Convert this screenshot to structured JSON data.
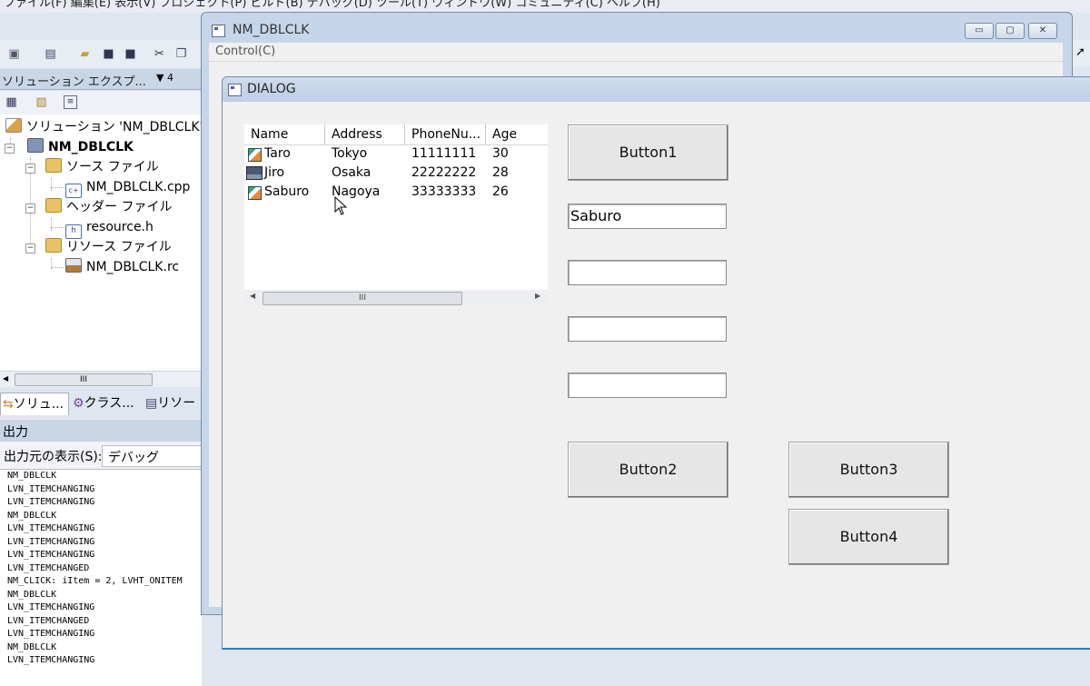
{
  "ide": {
    "menubar_text": "ファイル(F)   編集(E)   表示(V)   プロジェクト(P)   ビルド(B)   デバッグ(D)   ツール(T)   ウィンドウ(W)   コミュニティ(C)   ヘルプ(H)",
    "solution_explorer": {
      "title": "ソリューション エクスプ...",
      "pin": "▼ 4",
      "tree": {
        "solution": "ソリューション 'NM_DBLCLK'",
        "project": "NM_DBLCLK",
        "source_folder": "ソース ファイル",
        "source_file": "NM_DBLCLK.cpp",
        "header_folder": "ヘッダー ファイル",
        "header_file": "resource.h",
        "resource_folder": "リソース ファイル",
        "resource_file": "NM_DBLCLK.rc"
      },
      "scroll_thumb": "III",
      "tabs": [
        "ソリュ...",
        "クラス...",
        "リソー"
      ]
    },
    "output": {
      "title": "出力",
      "source_label": "出力元の表示(S):",
      "source_value": "デバッグ",
      "log": [
        "NM_DBLCLK",
        "LVN_ITEMCHANGING",
        "LVN_ITEMCHANGING",
        "NM_DBLCLK",
        "LVN_ITEMCHANGING",
        "LVN_ITEMCHANGING",
        "LVN_ITEMCHANGING",
        "LVN_ITEMCHANGED",
        "NM_CLICK: iItem = 2, LVHT_ONITEM",
        "NM_DBLCLK",
        "LVN_ITEMCHANGING",
        "LVN_ITEMCHANGED",
        "LVN_ITEMCHANGING",
        "NM_DBLCLK",
        "LVN_ITEMCHANGING"
      ]
    }
  },
  "main_window": {
    "title": "NM_DBLCLK",
    "menu": "Control(C)",
    "caption_buttons": {
      "minimize": "▭",
      "maximize": "▢",
      "close": "✕"
    }
  },
  "dialog": {
    "title": "DIALOG",
    "listview": {
      "columns": [
        "Name",
        "Address",
        "PhoneNu...",
        "Age"
      ],
      "rows": [
        {
          "name": "Taro",
          "address": "Tokyo",
          "phone": "11111111",
          "age": "30",
          "icon": "pencil-icon"
        },
        {
          "name": "Jiro",
          "address": "Osaka",
          "phone": "22222222",
          "age": "28",
          "icon": "computer-icon"
        },
        {
          "name": "Saburo",
          "address": "Nagoya",
          "phone": "33333333",
          "age": "26",
          "icon": "pencil-icon"
        }
      ],
      "scroll_thumb": "III"
    },
    "button1": "Button1",
    "edit1": "Saburo",
    "edit2": "",
    "edit3": "",
    "edit4": "",
    "button2": "Button2",
    "button3": "Button3",
    "button4": "Button4"
  }
}
